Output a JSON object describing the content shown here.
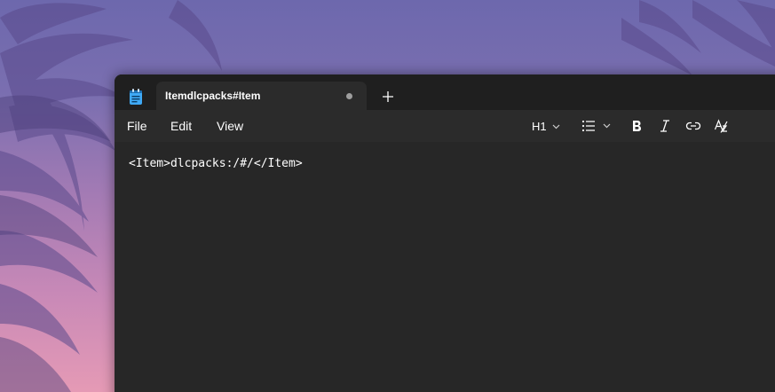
{
  "window": {
    "tab_title": "Itemdlcpacks#Item",
    "new_tab_symbol": "+"
  },
  "menu": {
    "file": "File",
    "edit": "Edit",
    "view": "View"
  },
  "toolbar": {
    "heading_label": "H1",
    "icons": [
      "chevron-down-icon",
      "bulleted-list-icon",
      "bold-icon",
      "italic-icon",
      "link-icon",
      "clear-formatting-icon"
    ]
  },
  "editor": {
    "content": "<Item>dlcpacks:/#/</Item>"
  },
  "colors": {
    "titlebar": "#1f1f1f",
    "tab": "#2b2b2b",
    "editor": "#272727",
    "text": "#ffffff",
    "app_icon": "#3fa9f5"
  }
}
